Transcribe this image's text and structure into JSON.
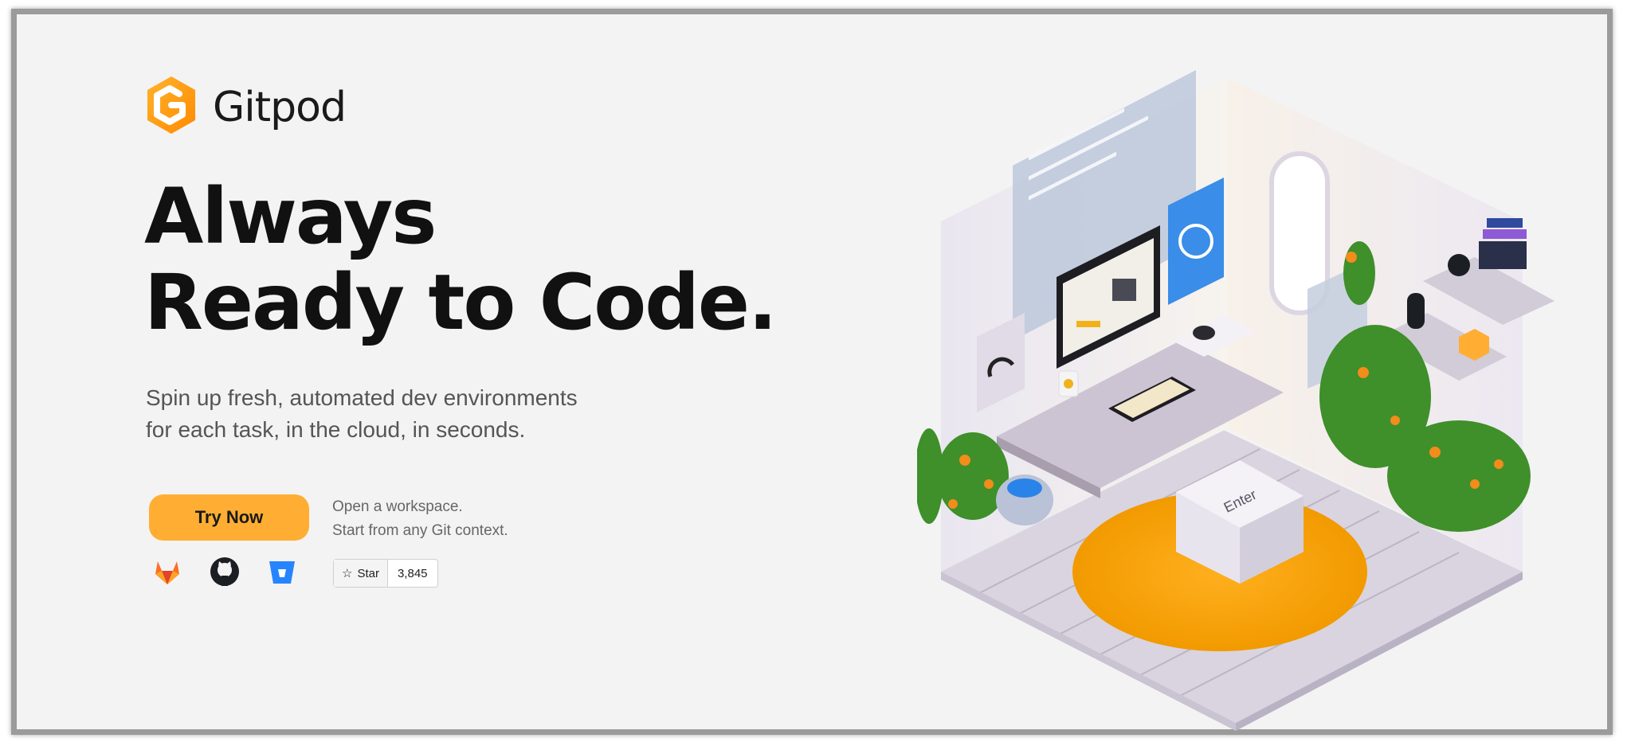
{
  "brand": {
    "name": "Gitpod"
  },
  "hero": {
    "headline_line1": "Always",
    "headline_line2": "Ready to Code.",
    "subtitle_line1": "Spin up fresh, automated dev environments",
    "subtitle_line2": "for each task, in the cloud, in seconds."
  },
  "cta": {
    "try_now": "Try Now",
    "note_line1": "Open a workspace.",
    "note_line2": "Start from any Git context."
  },
  "providers": [
    "gitlab-icon",
    "github-icon",
    "bitbucket-icon"
  ],
  "github_star": {
    "label": "Star",
    "count": "3,845"
  },
  "illustration": {
    "key_label": "Enter"
  },
  "colors": {
    "accent": "#ffae33",
    "background": "#f3f3f3",
    "text": "#111111"
  }
}
